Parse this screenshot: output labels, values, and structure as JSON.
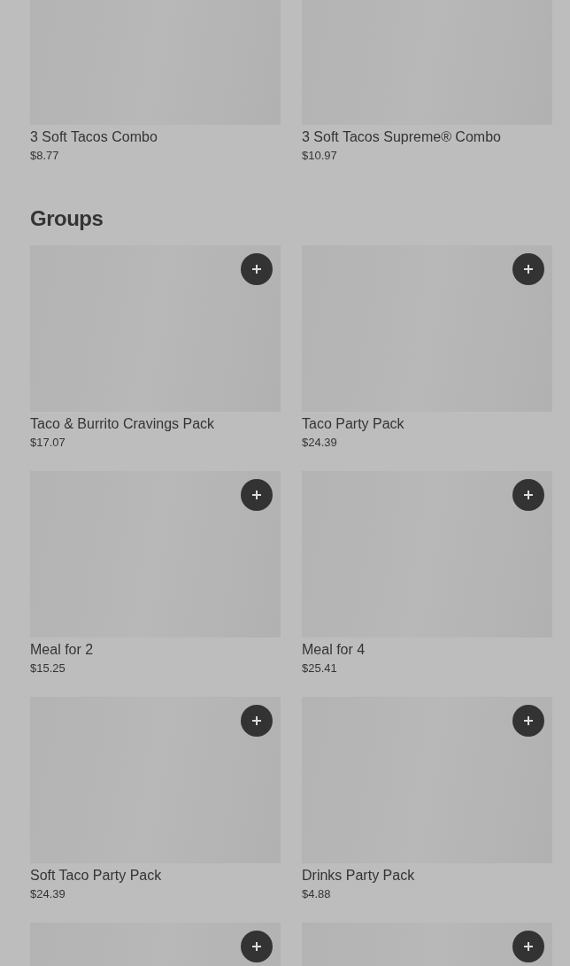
{
  "sections": [
    {
      "kind": "cropped",
      "items": [
        {
          "kind": "item",
          "name": "3 Soft Tacos Combo",
          "price": "$8.77"
        },
        {
          "kind": "item",
          "name": "3 Soft Tacos Supreme® Combo",
          "price": "$10.97"
        }
      ]
    },
    {
      "kind": "full",
      "title": "Groups",
      "items": [
        {
          "kind": "item",
          "name": "Taco & Burrito Cravings Pack",
          "price": "$17.07"
        },
        {
          "kind": "item",
          "name": "Taco Party Pack",
          "price": "$24.39"
        },
        {
          "kind": "item",
          "name": "Meal for 2",
          "price": "$15.25"
        },
        {
          "kind": "item",
          "name": "Meal for 4",
          "price": "$25.41"
        },
        {
          "kind": "item",
          "name": "Soft Taco Party Pack",
          "price": "$24.39"
        },
        {
          "kind": "item",
          "name": "Drinks Party Pack",
          "price": "$4.88"
        },
        {
          "kind": "image-only"
        },
        {
          "kind": "image-only"
        }
      ]
    }
  ]
}
